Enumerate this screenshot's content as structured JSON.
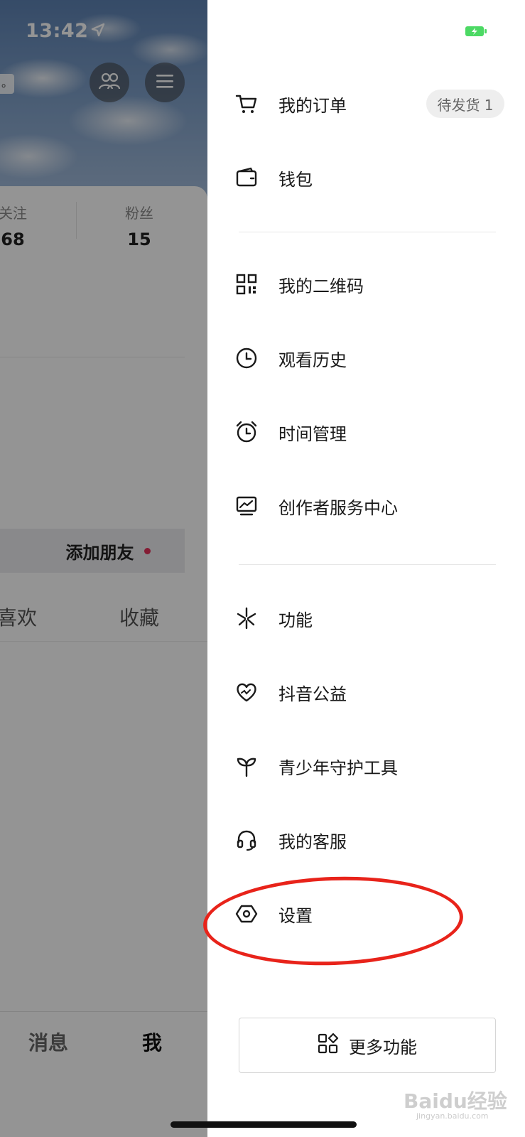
{
  "status_bar": {
    "time": "13:42"
  },
  "background_profile": {
    "truncated_text": "。",
    "stats": {
      "following_label": "关注",
      "following_value": "68",
      "fans_label": "粉丝",
      "fans_value": "15"
    },
    "add_friend_label": "添加朋友",
    "tabs": {
      "like": "喜欢",
      "favorites": "收藏"
    },
    "bottom_nav": {
      "messages": "消息",
      "me": "我"
    }
  },
  "drawer": {
    "order_badge": "待发货 1",
    "sections": [
      [
        {
          "label": "我的订单",
          "icon": "cart-icon"
        },
        {
          "label": "钱包",
          "icon": "wallet-icon"
        }
      ],
      [
        {
          "label": "我的二维码",
          "icon": "qr-code-icon"
        },
        {
          "label": "观看历史",
          "icon": "clock-icon"
        },
        {
          "label": "时间管理",
          "icon": "alarm-clock-icon"
        },
        {
          "label": "创作者服务中心",
          "icon": "monitor-chart-icon"
        }
      ],
      [
        {
          "label": "功能",
          "icon": "sparkle-icon"
        },
        {
          "label": "抖音公益",
          "icon": "heart-icon"
        },
        {
          "label": "青少年守护工具",
          "icon": "sprout-icon"
        },
        {
          "label": "我的客服",
          "icon": "headset-icon"
        },
        {
          "label": "设置",
          "icon": "hexagon-settings-icon"
        }
      ]
    ],
    "more_button": {
      "label": "更多功能",
      "icon": "apps-grid-icon"
    }
  },
  "annotation": {
    "color": "#e8231a"
  },
  "watermark": {
    "main": "Baidu经验",
    "sub": "jingyan.baidu.com"
  },
  "colors": {
    "accent_dot": "#e4315a",
    "battery": "#4cd964"
  }
}
